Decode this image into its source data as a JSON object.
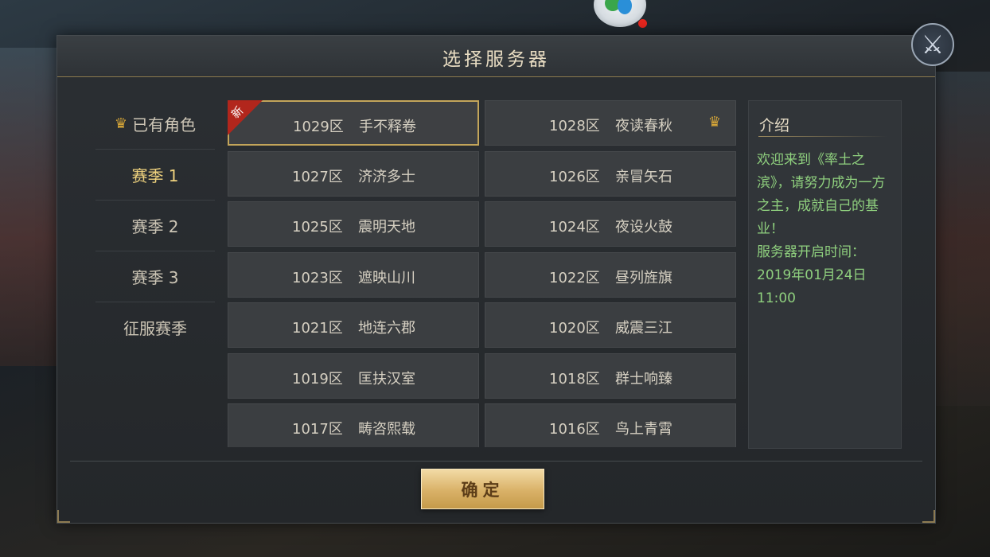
{
  "dialog": {
    "title": "选择服务器",
    "confirm_label": "确定"
  },
  "sidebar": {
    "items": [
      {
        "label": "已有角色",
        "icon": "helmet-icon",
        "active": false
      },
      {
        "label": "赛季 1",
        "active": true
      },
      {
        "label": "赛季 2",
        "active": false
      },
      {
        "label": "赛季 3",
        "active": false
      },
      {
        "label": "征服赛季",
        "active": false
      }
    ]
  },
  "servers": [
    {
      "num": "1029区",
      "name": "手不释卷",
      "selected": true,
      "new_tag": "新"
    },
    {
      "num": "1028区",
      "name": "夜读春秋",
      "has_role": true
    },
    {
      "num": "1027区",
      "name": "济济多士"
    },
    {
      "num": "1026区",
      "name": "亲冒矢石"
    },
    {
      "num": "1025区",
      "name": "震明天地"
    },
    {
      "num": "1024区",
      "name": "夜设火鼓"
    },
    {
      "num": "1023区",
      "name": "遮映山川"
    },
    {
      "num": "1022区",
      "name": "昼列旌旗"
    },
    {
      "num": "1021区",
      "name": "地连六郡"
    },
    {
      "num": "1020区",
      "name": "威震三江"
    },
    {
      "num": "1019区",
      "name": "匡扶汉室"
    },
    {
      "num": "1018区",
      "name": "群士响臻"
    },
    {
      "num": "1017区",
      "name": "畴咨熙载"
    },
    {
      "num": "1016区",
      "name": "鸟上青霄"
    }
  ],
  "intro": {
    "title": "介绍",
    "text": "欢迎来到《率土之滨》，请努力成为一方之主，成就自己的基业！",
    "time_label": "服务器开启时间：",
    "time_value": "2019年01月24日 11:00"
  },
  "colors": {
    "accent_gold": "#f0d37e",
    "intro_text": "#8fd07e",
    "new_ribbon": "#b2261c"
  }
}
